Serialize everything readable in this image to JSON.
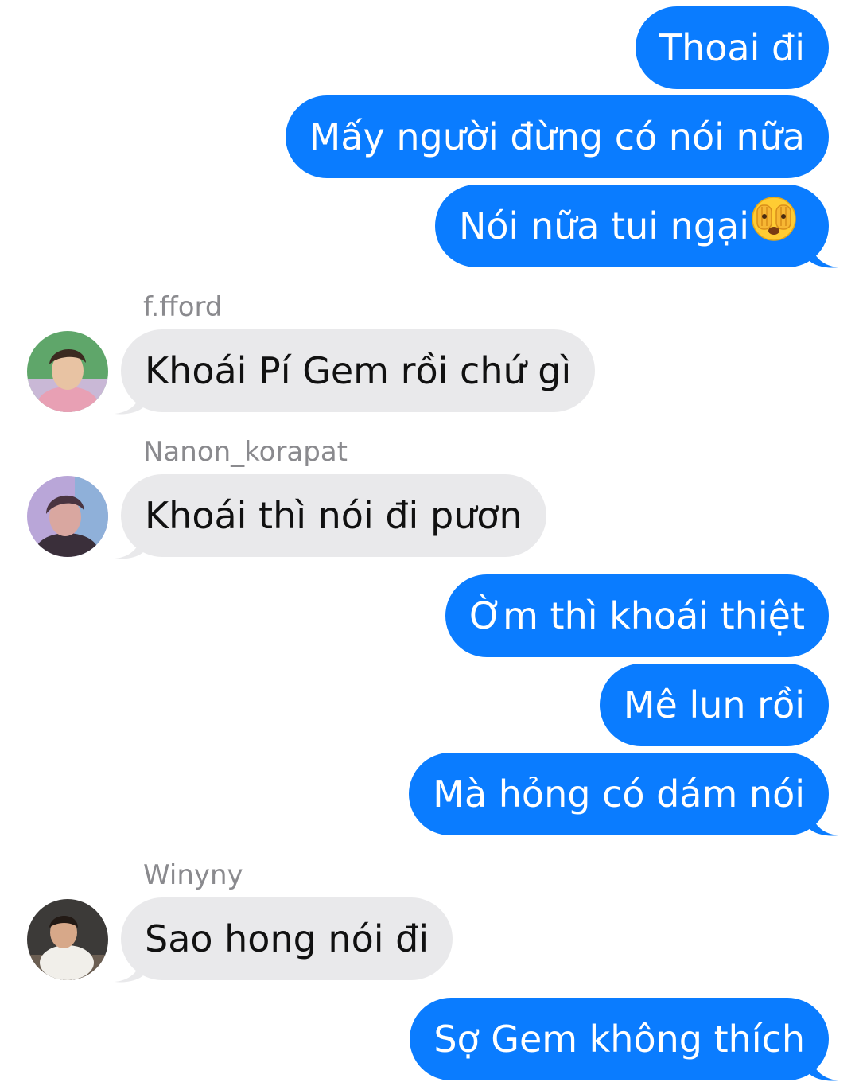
{
  "colors": {
    "outgoing_bubble": "#0a7cff",
    "incoming_bubble": "#e9e9eb",
    "sender_name": "#8a8a8e"
  },
  "messages": [
    {
      "side": "out",
      "text": "Thoai đi"
    },
    {
      "side": "out",
      "text": "Mấy người đừng có nói nữa"
    },
    {
      "side": "out",
      "text": "Nói nữa tui ngại",
      "emoji": "face-with-peeking-eye-emoji"
    },
    {
      "side": "in",
      "sender": "f.fford",
      "text": "Khoái Pí Gem rồi chứ gì"
    },
    {
      "side": "in",
      "sender": "Nanon_korapat",
      "text": "Khoái thì nói đi pươn"
    },
    {
      "side": "out",
      "text": "Ờm thì khoái thiệt"
    },
    {
      "side": "out",
      "text": "Mê lun rồi"
    },
    {
      "side": "out",
      "text": "Mà hỏng có dám nói"
    },
    {
      "side": "in",
      "sender": "Winyny",
      "text": "Sao hong nói đi"
    },
    {
      "side": "out",
      "text": "Sợ Gem không thích"
    }
  ]
}
